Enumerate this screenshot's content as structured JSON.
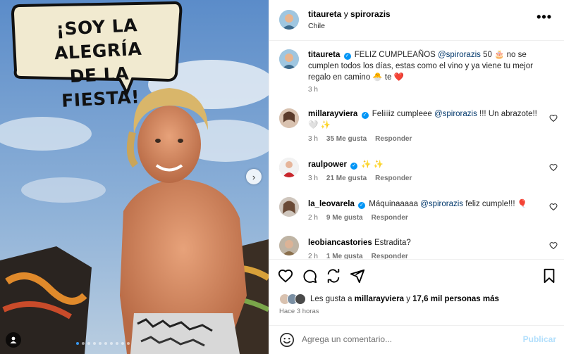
{
  "media": {
    "bubble_text": "¡SOY LA ALEGRÍA DE LA FIESTA!",
    "bubble_line1": "¡SOY LA ALEGRÍA",
    "bubble_line2": "DE LA FIESTA!",
    "next_icon": "chevron-right-icon",
    "carousel_dots": 10,
    "carousel_active": 1
  },
  "header": {
    "user1": "titaureta",
    "joiner": "y",
    "user2": "spirorazis",
    "location": "Chile",
    "more_icon": "more-horizontal-icon"
  },
  "caption": {
    "username": "titaureta",
    "text_before": "FELIZ CUMPLEAÑOS ",
    "mention": "@spirorazis",
    "text_after": " 50 🎂 no se cumplen todos los días, estas como el vino y ya viene tu mejor regalo en camino 🐣 te ❤️",
    "time": "3 h"
  },
  "comments": [
    {
      "username": "millarayviera",
      "verified": true,
      "text_before": "Feliiiiz cumpleee ",
      "mention": "@spirorazis",
      "text_after": " !!! Un abrazote!! 🤍 ✨",
      "time": "3 h",
      "likes": "35 Me gusta",
      "reply": "Responder"
    },
    {
      "username": "raulpower",
      "verified": true,
      "text_before": "✨ ✨",
      "mention": "",
      "text_after": "",
      "time": "3 h",
      "likes": "21 Me gusta",
      "reply": "Responder"
    },
    {
      "username": "la_leovarela",
      "verified": true,
      "text_before": "Máquinaaaaa ",
      "mention": "@spirorazis",
      "text_after": " feliz cumple!!! 🎈",
      "time": "2 h",
      "likes": "9 Me gusta",
      "reply": "Responder"
    },
    {
      "username": "leobiancastories",
      "verified": false,
      "text_before": "Estradita?",
      "mention": "",
      "text_after": "",
      "time": "2 h",
      "likes": "1 Me gusta",
      "reply": "Responder"
    }
  ],
  "actions": {
    "icons": [
      "heart-icon",
      "comment-icon",
      "share-icon",
      "send-icon",
      "bookmark-icon"
    ],
    "likes_prefix": "Les gusta a ",
    "likes_user": "millarayviera",
    "likes_mid": " y ",
    "likes_count": "17,6 mil personas más",
    "ago": "Hace 3 horas"
  },
  "comment_box": {
    "placeholder": "Agrega un comentario...",
    "publish": "Publicar"
  },
  "colors": {
    "link": "#00376b",
    "verified": "#0095f6",
    "publish_disabled": "#b2dffc",
    "meta": "#737373"
  }
}
